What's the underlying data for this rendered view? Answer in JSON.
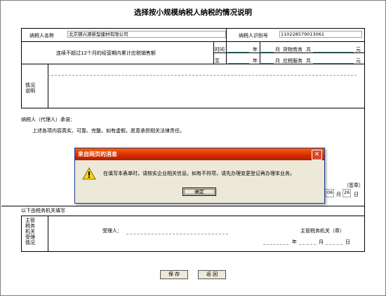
{
  "page": {
    "title": "选择按小规模纳税人纳税的情况说明"
  },
  "row1": {
    "taxpayer_name_label": "纳税人名称",
    "taxpayer_name_value": "北京钢兴源新型建材有限公司",
    "taxpayer_id_label": "纳税人识别号",
    "taxpayer_id_value": "110228579013061"
  },
  "row2": {
    "desc": "连续不超过12个月的经营期内累计应税销售额",
    "time_label": "时间",
    "to_label": "至",
    "year_char": "年",
    "month_char": "月",
    "goods_label": "货物劳务",
    "services_label": "应税服务",
    "total_char": "共",
    "yuan_char": "元"
  },
  "situation": {
    "label": "情况\n说明"
  },
  "promise": {
    "heading": "纳税人（代理人）承诺：",
    "body": "上述各项内容真实、可靠、完整。如有虚假，愿意承担相关法律责任。",
    "sign": "（签章）",
    "date_month": "06",
    "date_day": "26",
    "month_char": "月",
    "day_char": "日"
  },
  "office": {
    "heading": "以下由税务机关填写",
    "side_label": "主管\n税务\n机关\n受理\n情况",
    "acceptor_label": "受理人：",
    "authority_label": "主管税务机关（章）",
    "year_char": "年",
    "month_char": "月",
    "day_char": "日"
  },
  "buttons": {
    "save": "保 存",
    "back": "返 回"
  },
  "dialog": {
    "title": "来自网页的消息",
    "message": "在填写本表单时，请核实企业相关信息。如有不符项，请先办理变更登记再办理本业务。",
    "ok": "确定"
  },
  "colors": {
    "dialog_title": "#d42b00",
    "underline": "#4aa"
  }
}
